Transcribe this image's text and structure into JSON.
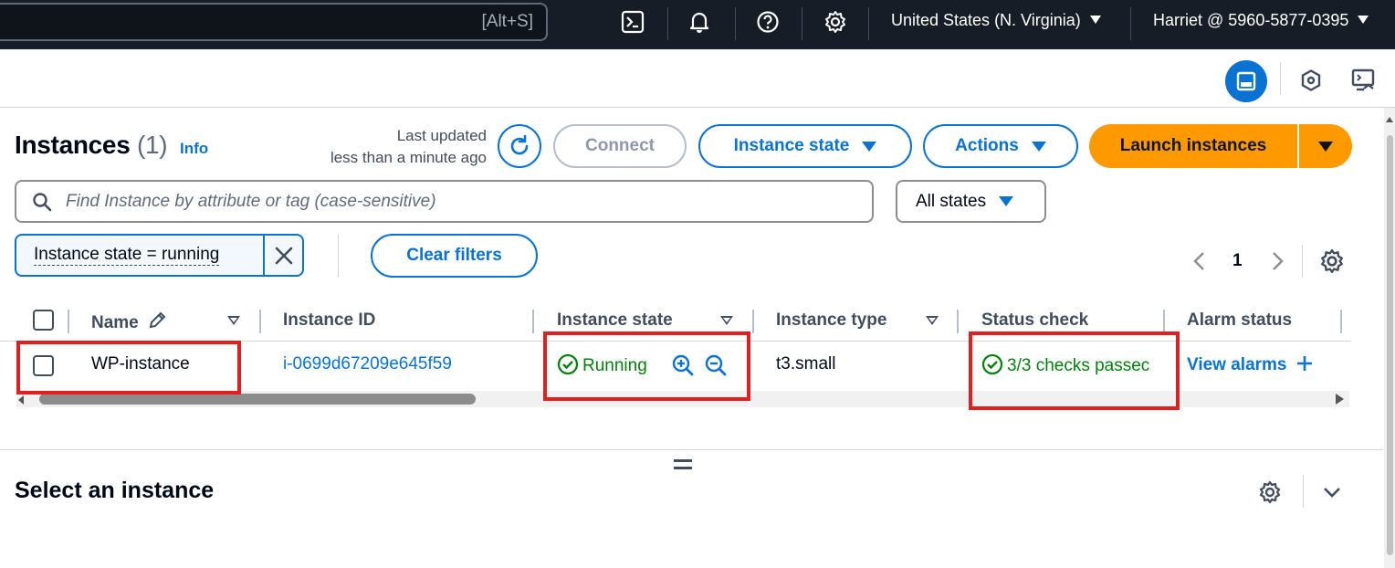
{
  "topnav": {
    "search_shortcut": "[Alt+S]",
    "region": "United States (N. Virginia)",
    "account": "Harriet @ 5960-5877-0395",
    "icons": [
      "cloudshell-icon",
      "bell-icon",
      "help-icon",
      "gear-icon"
    ]
  },
  "header": {
    "title": "Instances",
    "count": "(1)",
    "info": "Info",
    "last_updated_line1": "Last updated",
    "last_updated_line2": "less than a minute ago",
    "connect_label": "Connect",
    "instance_state_label": "Instance state",
    "actions_label": "Actions",
    "launch_label": "Launch instances"
  },
  "filters": {
    "search_placeholder": "Find Instance by attribute or tag (case-sensitive)",
    "states_value": "All states",
    "token_label": "Instance state = running",
    "clear_label": "Clear filters"
  },
  "pagination": {
    "current_page": "1"
  },
  "table": {
    "columns": [
      "Name",
      "Instance ID",
      "Instance state",
      "Instance type",
      "Status check",
      "Alarm status"
    ],
    "rows": [
      {
        "name": "WP-instance",
        "instance_id": "i-0699d67209e645f59",
        "state": "Running",
        "type": "t3.small",
        "status_check": "3/3 checks passec",
        "alarm_status": "View alarms"
      }
    ]
  },
  "split_panel": {
    "title": "Select an instance"
  },
  "colors": {
    "nav_bg": "#161d26",
    "accent": "#0972d3",
    "launch": "#ff9900",
    "success": "#037f0c",
    "annotation": "#e02020"
  }
}
